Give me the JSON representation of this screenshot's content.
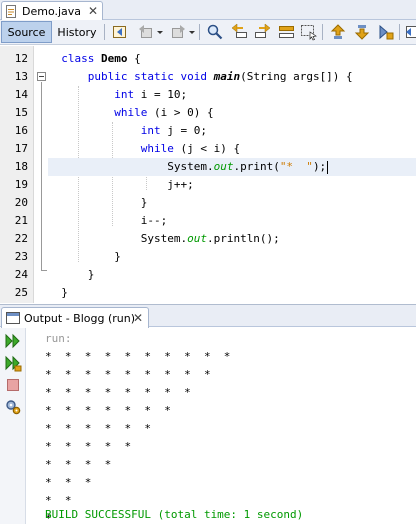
{
  "editor_tab": {
    "filename": "Demo.java",
    "close_glyph": "✕"
  },
  "toolbar": {
    "source_label": "Source",
    "history_label": "History",
    "icons": [
      "last-edit-icon",
      "back-icon",
      "forward-icon",
      "find-icon",
      "find-previous-icon",
      "find-next-icon",
      "toggle-highlight-icon",
      "toggle-rectangular-selection-icon",
      "previous-bookmark-icon",
      "next-bookmark-icon",
      "toggle-bookmark-icon",
      "shift-left-icon"
    ]
  },
  "code": {
    "line_numbers": [
      "12",
      "13",
      "14",
      "15",
      "16",
      "17",
      "18",
      "19",
      "20",
      "21",
      "22",
      "23",
      "24",
      "25"
    ],
    "current_line": "18",
    "lines": [
      {
        "indent": "  ",
        "kw1": "class",
        "rest1": " ",
        "cls": "Demo",
        "rest2": " {"
      },
      {
        "indent": "      ",
        "kw1": "public static void",
        "rest1": " ",
        "fn": "main",
        "rest2": "(String args[]) {"
      },
      {
        "indent": "          ",
        "kw1": "int",
        "rest1": " i = 10;"
      },
      {
        "indent": "          ",
        "kw1": "while",
        "rest1": " (i > 0) {"
      },
      {
        "indent": "              ",
        "kw1": "int",
        "rest1": " j = 0;"
      },
      {
        "indent": "              ",
        "kw1": "while",
        "rest1": " (j < i) {"
      },
      {
        "indent": "                  ",
        "pre": "System.",
        "fld": "out",
        "mid": ".print(",
        "str": "\"*  \"",
        "rest1": ");"
      },
      {
        "indent": "                  ",
        "rest1": "j++;"
      },
      {
        "indent": "              ",
        "rest1": "}"
      },
      {
        "indent": "              ",
        "rest1": "i--;"
      },
      {
        "indent": "              ",
        "pre": "System.",
        "fld": "out",
        "mid": ".println();"
      },
      {
        "indent": "          ",
        "rest1": "}"
      },
      {
        "indent": "      ",
        "rest1": "}"
      },
      {
        "indent": "  ",
        "rest1": "}"
      }
    ]
  },
  "output": {
    "tab_label": "Output - Blogg (run)",
    "close_glyph": "✕",
    "side_icons": [
      "rerun-icon",
      "rerun-with-options-icon",
      "stop-icon",
      "settings-icon"
    ],
    "lines": [
      {
        "kind": "run",
        "text": "run:"
      },
      {
        "kind": "normal",
        "text": "*  *  *  *  *  *  *  *  *  *"
      },
      {
        "kind": "normal",
        "text": "*  *  *  *  *  *  *  *  *"
      },
      {
        "kind": "normal",
        "text": "*  *  *  *  *  *  *  *"
      },
      {
        "kind": "normal",
        "text": "*  *  *  *  *  *  *"
      },
      {
        "kind": "normal",
        "text": "*  *  *  *  *  *"
      },
      {
        "kind": "normal",
        "text": "*  *  *  *  *"
      },
      {
        "kind": "normal",
        "text": "*  *  *  *"
      },
      {
        "kind": "normal",
        "text": "*  *  *"
      },
      {
        "kind": "normal",
        "text": "*  *"
      },
      {
        "kind": "normal",
        "text": "*"
      },
      {
        "kind": "success",
        "text": "BUILD SUCCESSFUL (total time: 1 second)"
      }
    ]
  },
  "colors": {
    "keyword": "#0000e6",
    "field": "#009900",
    "string": "#ce7b00",
    "success": "#009900",
    "run": "#999999",
    "current_line": "#e9eff8",
    "source_button": "#bcd1ec"
  }
}
